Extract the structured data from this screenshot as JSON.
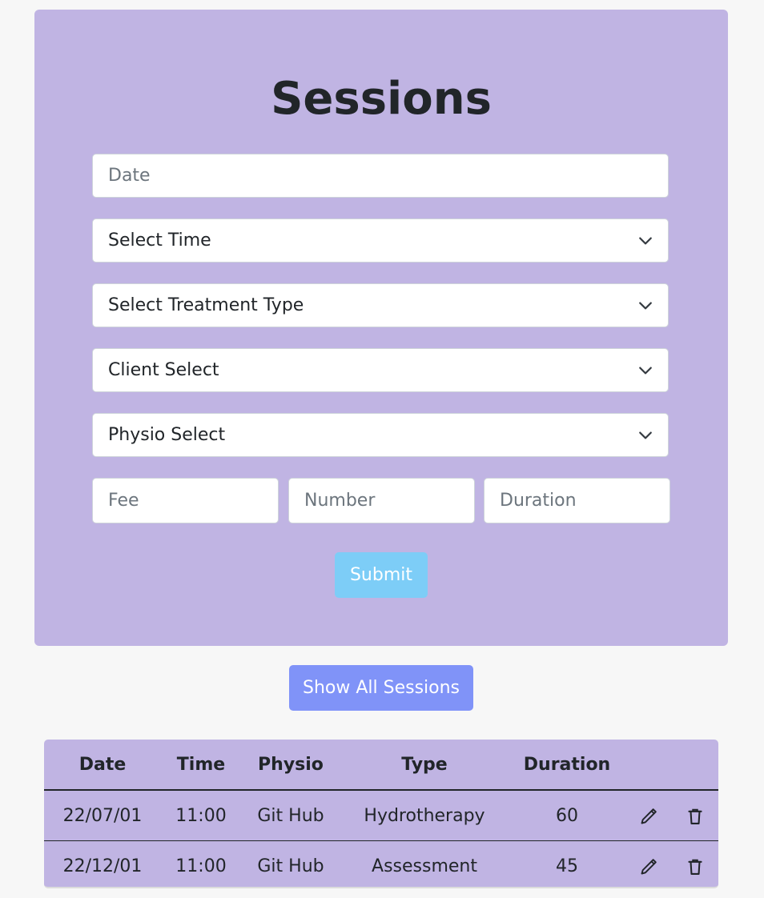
{
  "form": {
    "title": "Sessions",
    "date_placeholder": "Date",
    "time_select": "Select Time",
    "treatment_select": "Select Treatment Type",
    "client_select": "Client Select",
    "physio_select": "Physio Select",
    "fee_placeholder": "Fee",
    "number_placeholder": "Number",
    "duration_placeholder": "Duration",
    "submit_label": "Submit"
  },
  "show_all_label": "Show All Sessions",
  "table": {
    "headers": [
      "Date",
      "Time",
      "Physio",
      "Type",
      "Duration"
    ],
    "rows": [
      {
        "date": "22/07/01",
        "time": "11:00",
        "physio": "Git Hub",
        "type": "Hydrotherapy",
        "duration": "60"
      },
      {
        "date": "22/12/01",
        "time": "11:00",
        "physio": "Git Hub",
        "type": "Assessment",
        "duration": "45"
      }
    ]
  },
  "icons": {
    "select_arrow": "chevron-down-icon",
    "edit": "pencil-icon",
    "delete": "trash-icon"
  },
  "colors": {
    "card_bg": "#c0b4e3",
    "submit_bg": "#7dcdf7",
    "show_all_bg": "#8093f8",
    "page_bg": "#f7f7f7"
  }
}
